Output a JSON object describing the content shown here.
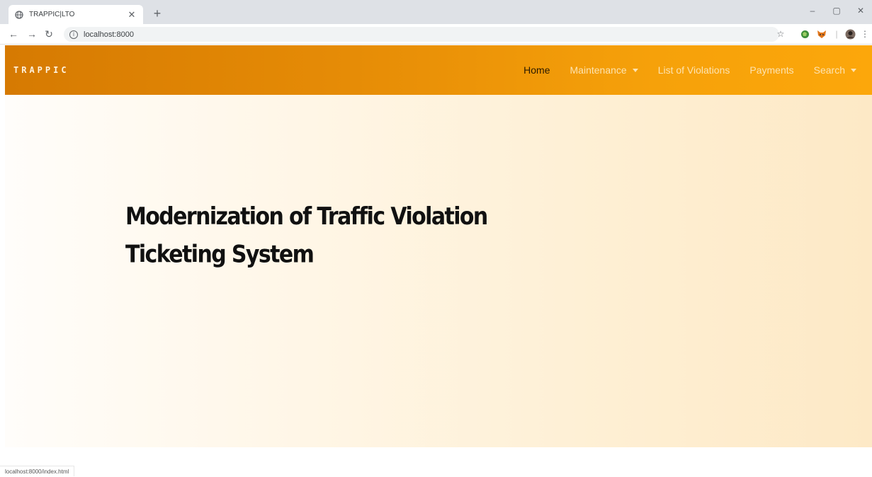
{
  "browser": {
    "tab_title": "TRAPPIC|LTO",
    "url": "localhost:8000",
    "status_url": "localhost:8000/index.html"
  },
  "site": {
    "brand": "TRAPPIC",
    "nav": [
      {
        "label": "Home",
        "active": true,
        "dropdown": false
      },
      {
        "label": "Maintenance",
        "active": false,
        "dropdown": true
      },
      {
        "label": "List of Violations",
        "active": false,
        "dropdown": false
      },
      {
        "label": "Payments",
        "active": false,
        "dropdown": false
      },
      {
        "label": "Search",
        "active": false,
        "dropdown": true
      }
    ],
    "hero": {
      "line1": "Modernization of Traffic Violation",
      "line2": "Ticketing System"
    }
  },
  "colors": {
    "navbar_start": "#d67a02",
    "navbar_end": "#fca70b",
    "hero_tint": "#fde9c6"
  },
  "icons": [
    "globe-icon",
    "close-icon",
    "plus-icon",
    "back-icon",
    "forward-icon",
    "reload-icon",
    "info-icon",
    "star-icon",
    "extension-icon",
    "fox-icon",
    "profile-icon",
    "menu-icon",
    "minimize-icon",
    "maximize-icon",
    "window-close-icon",
    "caret-down-icon"
  ]
}
